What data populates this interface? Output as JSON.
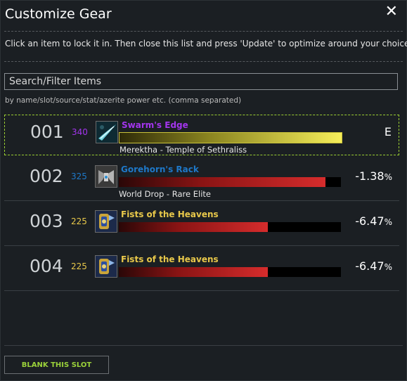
{
  "dialog": {
    "title": "Customize Gear",
    "close_symbol": "✕",
    "instructions": "Click an item to lock it in. Then close this list and press 'Update' to optimize around your choice."
  },
  "search": {
    "placeholder": "Search/Filter Items",
    "value": "",
    "hint": "by name/slot/source/stat/azerite power etc. (comma separated)"
  },
  "colors": {
    "epic": "#a335ee",
    "rare": "#1e78c8",
    "legendary_gold": "#e8c84a",
    "accent_green": "#9bd23a"
  },
  "items": [
    {
      "rank": "001",
      "ilvl": "340",
      "ilvl_color": "#a335ee",
      "name": "Swarm's Edge",
      "name_color": "#a335ee",
      "source": "Merektha - Temple of Sethraliss",
      "delta": "E",
      "delta_pct": "",
      "fill_fraction": 1.0,
      "bar_style": "gold",
      "icon": "blade-icon",
      "selected": true
    },
    {
      "rank": "002",
      "ilvl": "325",
      "ilvl_color": "#1e78c8",
      "name": "Gorehorn's Rack",
      "name_color": "#1e78c8",
      "source": "World Drop - Rare Elite",
      "delta": "-1.38",
      "delta_pct": "%",
      "fill_fraction": 0.93,
      "bar_style": "red",
      "icon": "horn-icon",
      "selected": false
    },
    {
      "rank": "003",
      "ilvl": "225",
      "ilvl_color": "#e8c84a",
      "name": "Fists of the Heavens",
      "name_color": "#e8c84a",
      "source": "",
      "delta": "-6.47",
      "delta_pct": "%",
      "fill_fraction": 0.67,
      "bar_style": "red",
      "icon": "fist-weapon-icon",
      "selected": false
    },
    {
      "rank": "004",
      "ilvl": "225",
      "ilvl_color": "#e8c84a",
      "name": "Fists of the Heavens",
      "name_color": "#e8c84a",
      "source": "",
      "delta": "-6.47",
      "delta_pct": "%",
      "fill_fraction": 0.67,
      "bar_style": "red",
      "icon": "fist-weapon-icon",
      "selected": false
    }
  ],
  "footer": {
    "blank_button_label": "BLANK THIS SLOT"
  }
}
